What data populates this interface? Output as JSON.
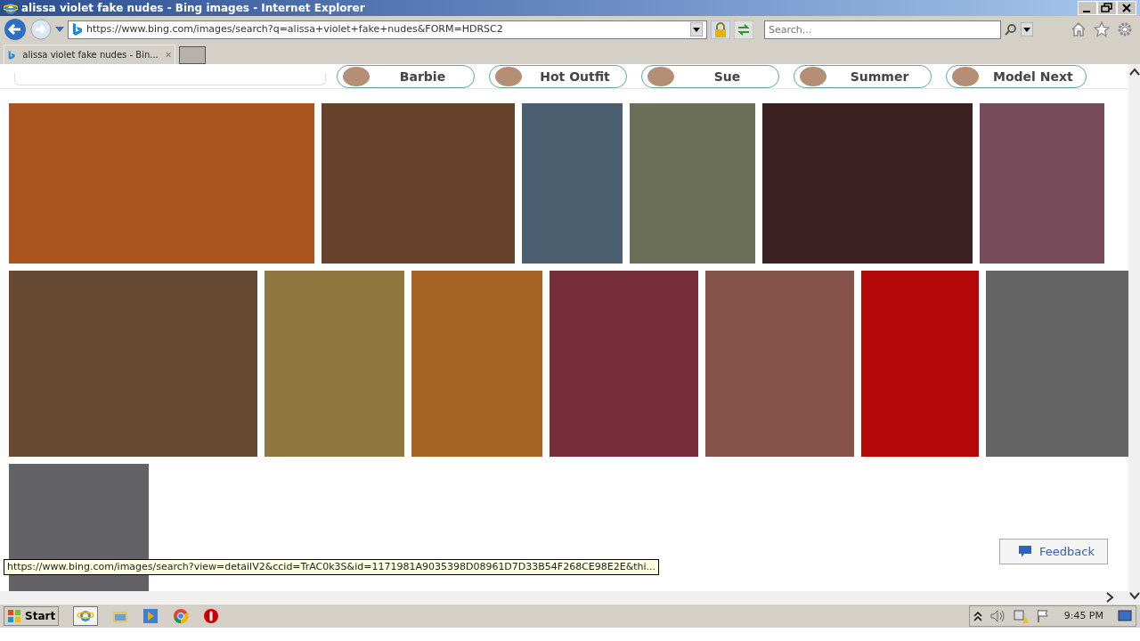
{
  "window": {
    "title": "alissa violet fake nudes - Bing images - Internet Explorer"
  },
  "address_bar": {
    "url": "https://www.bing.com/images/search?q=alissa+violet+fake+nudes&FORM=HDRSC2"
  },
  "search": {
    "placeholder": "Search..."
  },
  "tabs": [
    {
      "label": "alissa violet fake nudes - Bin...",
      "selected": true
    }
  ],
  "chips": [
    {
      "label": "Barbie"
    },
    {
      "label": "Hot Outfit"
    },
    {
      "label": "Sue"
    },
    {
      "label": "Summer"
    },
    {
      "label": "Model Next"
    }
  ],
  "tiles": [
    {
      "color": "#aa5420"
    },
    {
      "color": "#66412c"
    },
    {
      "color": "#4b5f70"
    },
    {
      "color": "#6c6f58"
    },
    {
      "color": "#3b2021"
    },
    {
      "color": "#774c5a"
    },
    {
      "color": "#654933"
    },
    {
      "color": "#90773f"
    },
    {
      "color": "#a66424"
    },
    {
      "color": "#752e39"
    },
    {
      "color": "#85534a"
    },
    {
      "color": "#b30807"
    },
    {
      "color": "#646464"
    },
    {
      "color": "#636267"
    }
  ],
  "status_url": "https://www.bing.com/images/search?view=detailV2&ccid=TrAC0k3S&id=1171981A9035398D08961D7D33B54F268CE98E2E&thi...",
  "feedback": {
    "label": "Feedback"
  },
  "taskbar": {
    "start": "Start",
    "clock": "9:45 PM"
  }
}
